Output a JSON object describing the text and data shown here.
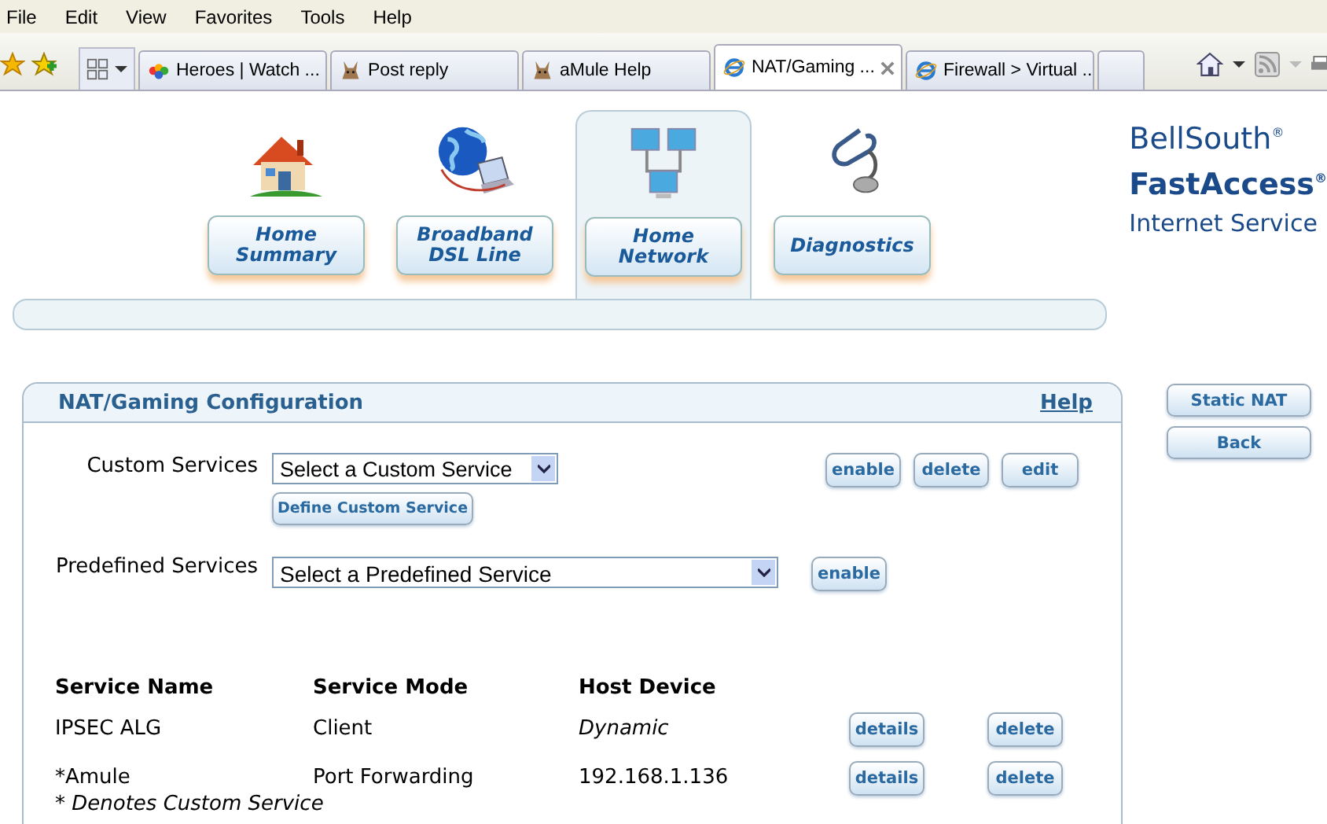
{
  "menu": [
    "File",
    "Edit",
    "View",
    "Favorites",
    "Tools",
    "Help"
  ],
  "browser_tabs": [
    {
      "title": "Heroes | Watch ...",
      "kind": "peacock",
      "selected": false
    },
    {
      "title": "Post reply",
      "kind": "mule",
      "selected": false
    },
    {
      "title": "aMule Help",
      "kind": "mule",
      "selected": false
    },
    {
      "title": "NAT/Gaming ...",
      "kind": "ie",
      "selected": true
    },
    {
      "title": "Firewall > Virtual ...",
      "kind": "ie",
      "selected": false
    }
  ],
  "nav": [
    {
      "label": "Home Summary",
      "kind": "house",
      "selected": false
    },
    {
      "label": "Broadband DSL Line",
      "kind": "globe",
      "selected": false
    },
    {
      "label": "Home Network",
      "kind": "network",
      "selected": true
    },
    {
      "label": "Diagnostics",
      "kind": "stethoscope",
      "selected": false
    }
  ],
  "logo": {
    "line_1": "BellSouth",
    "line_2": "FastAccess",
    "line_3": "Internet Service",
    "mark": "®"
  },
  "panel": {
    "title": "NAT/Gaming Configuration",
    "help": "Help",
    "custom": {
      "label": "Custom Services",
      "select": "Select a Custom Service",
      "buttons": [
        "enable",
        "delete",
        "edit"
      ],
      "define": "Define Custom Service"
    },
    "predefined": {
      "label": "Predefined Services",
      "select": "Select a Predefined Service",
      "buttons": [
        "enable"
      ]
    },
    "columns": [
      "Service Name",
      "Service Mode",
      "Host Device"
    ],
    "rows": [
      {
        "name": "IPSEC ALG",
        "mode": "Client",
        "host": "Dynamic",
        "host_italic": true,
        "buttons": [
          "details",
          "delete"
        ]
      },
      {
        "name": "*Amule",
        "mode": "Port Forwarding",
        "host": "192.168.1.136",
        "host_italic": false,
        "buttons": [
          "details",
          "delete"
        ]
      }
    ],
    "footnote": "* Denotes Custom Service"
  },
  "side_buttons": [
    "Static NAT",
    "Back"
  ]
}
